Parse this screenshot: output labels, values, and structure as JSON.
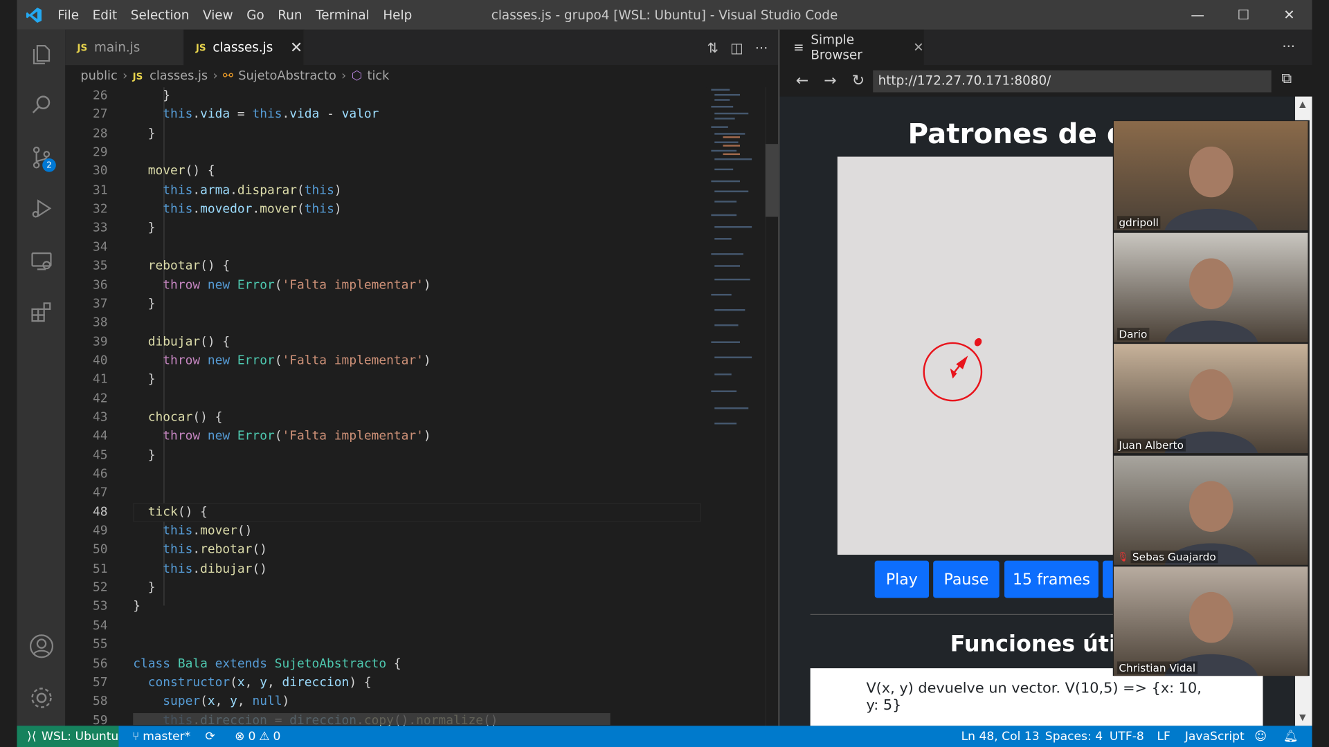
{
  "window": {
    "title": "classes.js - grupo4 [WSL: Ubuntu] - Visual Studio Code",
    "menu": [
      "File",
      "Edit",
      "Selection",
      "View",
      "Go",
      "Run",
      "Terminal",
      "Help"
    ]
  },
  "activity_bar": {
    "scm_badge": "2"
  },
  "tabs": [
    {
      "label": "main.js",
      "icon": "JS"
    },
    {
      "label": "classes.js",
      "icon": "JS"
    }
  ],
  "breadcrumb": [
    "public",
    "classes.js",
    "SujetoAbstracto",
    "tick"
  ],
  "code": {
    "current_line": 48,
    "lines": [
      {
        "n": "26",
        "html": "    }"
      },
      {
        "n": "27",
        "html": "    <span class='kw'>this</span>.<span class='var'>vida</span> = <span class='kw'>this</span>.<span class='var'>vida</span> - <span class='var'>valor</span>"
      },
      {
        "n": "28",
        "html": "  }"
      },
      {
        "n": "29",
        "html": ""
      },
      {
        "n": "30",
        "html": "  <span class='fn'>mover</span>() {"
      },
      {
        "n": "31",
        "html": "    <span class='kw'>this</span>.<span class='var'>arma</span>.<span class='fn'>disparar</span>(<span class='kw'>this</span>)"
      },
      {
        "n": "32",
        "html": "    <span class='kw'>this</span>.<span class='var'>movedor</span>.<span class='fn'>mover</span>(<span class='kw'>this</span>)"
      },
      {
        "n": "33",
        "html": "  }"
      },
      {
        "n": "34",
        "html": ""
      },
      {
        "n": "35",
        "html": "  <span class='fn'>rebotar</span>() {"
      },
      {
        "n": "36",
        "html": "    <span class='kw2'>throw</span> <span class='kw'>new</span> <span class='cls'>Error</span>(<span class='str'>'Falta implementar'</span>)"
      },
      {
        "n": "37",
        "html": "  }"
      },
      {
        "n": "38",
        "html": ""
      },
      {
        "n": "39",
        "html": "  <span class='fn'>dibujar</span>() {"
      },
      {
        "n": "40",
        "html": "    <span class='kw2'>throw</span> <span class='kw'>new</span> <span class='cls'>Error</span>(<span class='str'>'Falta implementar'</span>)"
      },
      {
        "n": "41",
        "html": "  }"
      },
      {
        "n": "42",
        "html": ""
      },
      {
        "n": "43",
        "html": "  <span class='fn'>chocar</span>() {"
      },
      {
        "n": "44",
        "html": "    <span class='kw2'>throw</span> <span class='kw'>new</span> <span class='cls'>Error</span>(<span class='str'>'Falta implementar'</span>)"
      },
      {
        "n": "45",
        "html": "  }"
      },
      {
        "n": "46",
        "html": ""
      },
      {
        "n": "47",
        "html": ""
      },
      {
        "n": "48",
        "html": "  <span class='fn'>tick</span>() {"
      },
      {
        "n": "49",
        "html": "    <span class='kw'>this</span>.<span class='fn'>mover</span>()"
      },
      {
        "n": "50",
        "html": "    <span class='kw'>this</span>.<span class='fn'>rebotar</span>()"
      },
      {
        "n": "51",
        "html": "    <span class='kw'>this</span>.<span class='fn'>dibujar</span>()"
      },
      {
        "n": "52",
        "html": "  }"
      },
      {
        "n": "53",
        "html": "}"
      },
      {
        "n": "54",
        "html": ""
      },
      {
        "n": "55",
        "html": ""
      },
      {
        "n": "56",
        "html": "<span class='kw'>class</span> <span class='cls'>Bala</span> <span class='kw'>extends</span> <span class='cls'>SujetoAbstracto</span> {"
      },
      {
        "n": "57",
        "html": "  <span class='kw'>constructor</span>(<span class='var'>x</span>, <span class='var'>y</span>, <span class='var'>direccion</span>) {"
      },
      {
        "n": "58",
        "html": "    <span class='kw'>super</span>(<span class='var'>x</span>, <span class='var'>y</span>, <span class='kw'>null</span>)"
      },
      {
        "n": "59",
        "html": "    <span class='kw'>this</span>.<span class='var'>direccion</span> = <span class='var'>direccion</span>.<span class='fn'>copy</span>().<span class='fn'>normalize</span>()"
      }
    ]
  },
  "browser": {
    "tab_label": "Simple Browser",
    "url": "http://172.27.70.171:8080/",
    "page_title": "Patrones de dis",
    "buttons": [
      "Play",
      "Pause",
      "15 frames"
    ],
    "section_title": "Funciones útile",
    "card_line": "V(x, y) devuelve un vector. V(10,5) => {x: 10, y: 5}"
  },
  "participants": [
    {
      "name": "gdripoll",
      "bg": "#8a6a4a"
    },
    {
      "name": "Dario",
      "bg": "#c9c6c0"
    },
    {
      "name": "Juan Alberto",
      "bg": "#c7b29a"
    },
    {
      "name": "Sebas Guajardo",
      "bg": "#a8a59e",
      "muted": true
    },
    {
      "name": "Christian Vidal",
      "bg": "#b8aca0"
    }
  ],
  "status": {
    "remote": "WSL: Ubuntu",
    "branch": "master*",
    "errors": "0",
    "warnings": "0",
    "cursor": "Ln 48, Col 13",
    "spaces": "Spaces: 4",
    "encoding": "UTF-8",
    "eol": "LF",
    "language": "JavaScript"
  },
  "colors": {
    "accent": "#007acc",
    "remote": "#16825d",
    "button": "#0d6efd"
  }
}
